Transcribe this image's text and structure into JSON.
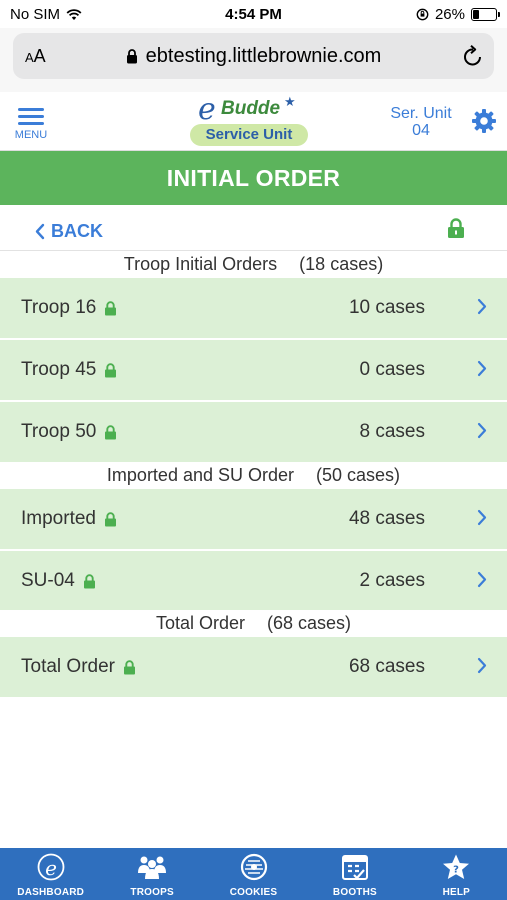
{
  "status_bar": {
    "carrier": "No SIM",
    "time": "4:54 PM",
    "battery_percent": "26%",
    "battery_level": 0.26
  },
  "browser": {
    "aa_label_big": "A",
    "aa_label_small": "A",
    "url": "ebtesting.littlebrownie.com"
  },
  "header": {
    "menu_label": "MENU",
    "logo_e": "e",
    "logo_budde": "Budde",
    "logo_sub": "Service Unit",
    "unit_line1": "Ser. Unit",
    "unit_line2": "04"
  },
  "page_title": "INITIAL ORDER",
  "back_label": "BACK",
  "sections": [
    {
      "title": "Troop Initial Orders",
      "count": "(18 cases)",
      "rows": [
        {
          "name": "Troop 16",
          "cases": "10 cases"
        },
        {
          "name": "Troop 45",
          "cases": "0 cases"
        },
        {
          "name": "Troop 50",
          "cases": "8 cases"
        }
      ]
    },
    {
      "title": "Imported and SU Order",
      "count": "(50 cases)",
      "rows": [
        {
          "name": "Imported",
          "cases": "48 cases"
        },
        {
          "name": "SU-04",
          "cases": "2 cases"
        }
      ]
    },
    {
      "title": "Total Order",
      "count": "(68 cases)",
      "rows": [
        {
          "name": "Total Order",
          "cases": "68 cases"
        }
      ]
    }
  ],
  "tabs": [
    {
      "label": "DASHBOARD",
      "icon": "ebudde-e-icon"
    },
    {
      "label": "TROOPS",
      "icon": "troops-people-icon"
    },
    {
      "label": "COOKIES",
      "icon": "cookie-icon"
    },
    {
      "label": "BOOTHS",
      "icon": "booth-calendar-icon"
    },
    {
      "label": "HELP",
      "icon": "help-star-icon"
    }
  ],
  "colors": {
    "accent_blue": "#3b7dd8",
    "title_green": "#5cb45c",
    "row_green": "#dcf0d6",
    "lock_green": "#4caf50",
    "tabbar_blue": "#2f6fbe"
  }
}
